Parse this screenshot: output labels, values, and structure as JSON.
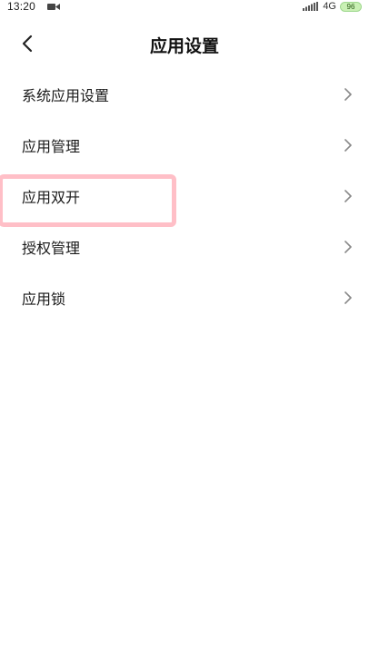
{
  "status_bar": {
    "time": "13:20",
    "network": "4G",
    "battery_level": "96"
  },
  "header": {
    "title": "应用设置"
  },
  "menu": {
    "items": [
      {
        "label": "系统应用设置"
      },
      {
        "label": "应用管理"
      },
      {
        "label": "应用双开"
      },
      {
        "label": "授权管理"
      },
      {
        "label": "应用锁"
      }
    ]
  },
  "colors": {
    "highlight": "#ffaab4",
    "battery": "#c9f0b4"
  }
}
